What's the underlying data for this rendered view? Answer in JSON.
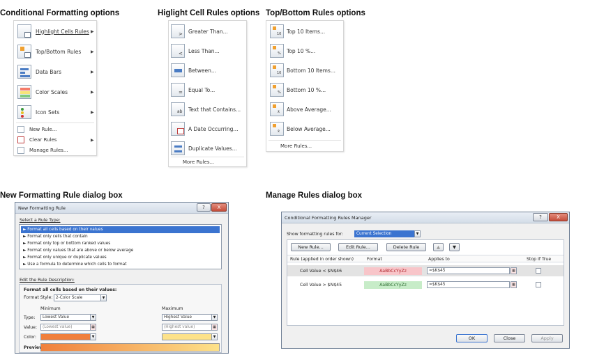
{
  "sections": {
    "cf_options": "Conditional Formatting options",
    "highlight_options": "Higlight Cell Rules options",
    "topbottom_options": "Top/Bottom Rules options",
    "new_rule_box": "New Formatting Rule dialog box",
    "manage_rules_box": "Manage Rules dialog box"
  },
  "cf_menu": {
    "items": [
      "Highlight Cells Rules",
      "Top/Bottom Rules",
      "Data Bars",
      "Color Scales",
      "Icon Sets"
    ],
    "small_items": [
      "New Rule...",
      "Clear Rules",
      "Manage Rules..."
    ]
  },
  "highlight_menu": {
    "items": [
      "Greater Than...",
      "Less Than...",
      "Between...",
      "Equal To...",
      "Text that Contains...",
      "A Date Occurring...",
      "Duplicate Values..."
    ],
    "more": "More Rules..."
  },
  "topbottom_menu": {
    "items": [
      "Top 10 Items...",
      "Top 10 %...",
      "Bottom 10 Items...",
      "Bottom 10 %...",
      "Above Average...",
      "Below Average..."
    ],
    "more": "More Rules..."
  },
  "new_rule_dialog": {
    "title": "New Formatting Rule",
    "help": "?",
    "close": "X",
    "select_type_label": "Select a Rule Type:",
    "rule_types": [
      "► Format all cells based on their values",
      "► Format only cells that contain",
      "► Format only top or bottom ranked values",
      "► Format only values that are above or below average",
      "► Format only unique or duplicate values",
      "► Use a formula to determine which cells to format"
    ],
    "edit_label": "Edit the Rule Description:",
    "format_all_label": "Format all cells based on their values:",
    "format_style_label": "Format Style:",
    "format_style_value": "2-Color Scale",
    "minimum_label": "Minimum",
    "maximum_label": "Maximum",
    "type_label": "Type:",
    "value_label": "Value:",
    "color_label": "Color:",
    "min_type": "Lowest Value",
    "max_type": "Highest Value",
    "min_value": "(Lowest value)",
    "max_value": "(Highest value)",
    "preview_label": "Preview:",
    "min_color": "#f07f3c",
    "max_color": "#fde28a"
  },
  "manage_dialog": {
    "title": "Conditional Formatting Rules Manager",
    "help": "?",
    "close": "X",
    "show_rules_label": "Show formatting rules for:",
    "show_rules_value": "Current Selection",
    "new_rule": "New Rule...",
    "edit_rule": "Edit Rule...",
    "delete_rule": "Delete Rule",
    "move_up": "▲",
    "move_down": "▼",
    "columns": [
      "Rule (applied in order shown)",
      "Format",
      "Applies to",
      "Stop If True"
    ],
    "rows": [
      {
        "rule": "Cell Value < $N$46",
        "format": "AaBbCcYyZz",
        "applies": "=$K$45",
        "format_bg": "#f8c5c9",
        "format_fg": "#b0262c"
      },
      {
        "rule": "Cell Value > $N$45",
        "format": "AaBbCcYyZz",
        "applies": "=$K$45",
        "format_bg": "#c7ecc8",
        "format_fg": "#2f6d32"
      }
    ],
    "ok": "OK",
    "close_btn": "Close",
    "apply": "Apply"
  }
}
